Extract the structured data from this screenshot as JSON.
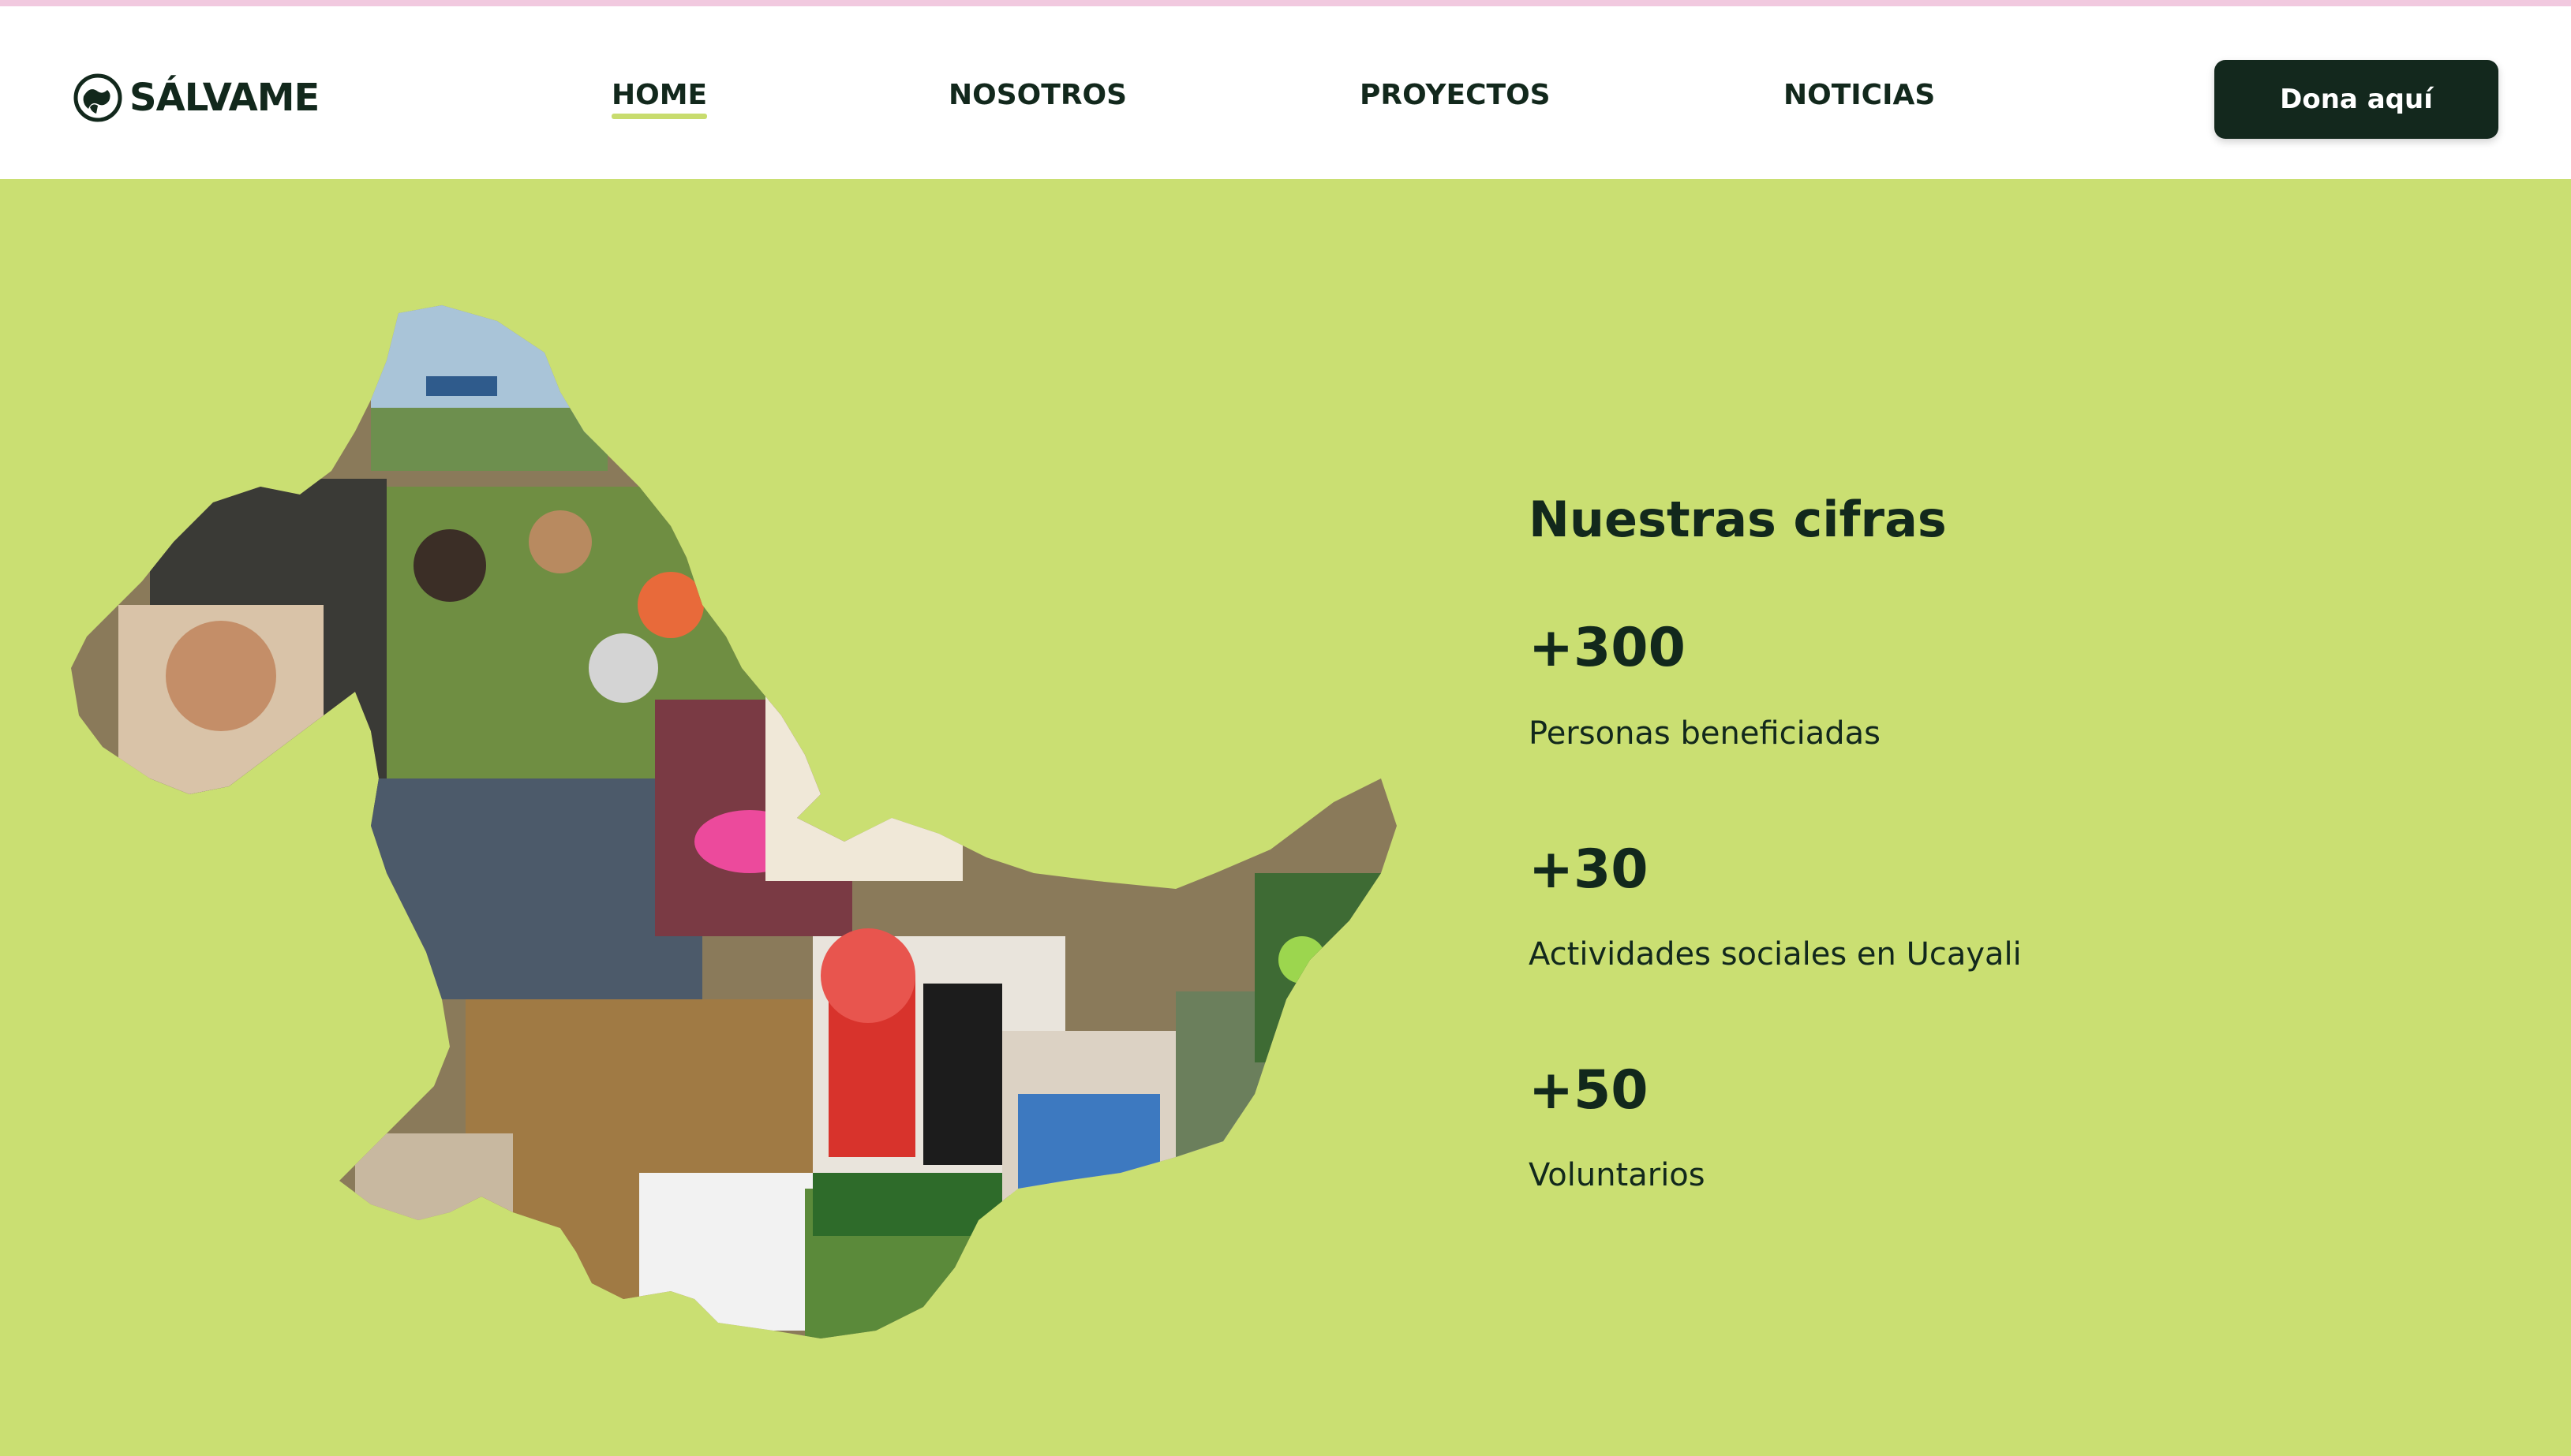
{
  "brand": {
    "name": "SÁLVAME",
    "logo_icon": "globe-hands-icon"
  },
  "nav": {
    "items": [
      {
        "label": "HOME",
        "active": true
      },
      {
        "label": "NOSOTROS",
        "active": false
      },
      {
        "label": "PROYECTOS",
        "active": false
      },
      {
        "label": "NOTICIAS",
        "active": false
      }
    ]
  },
  "cta": {
    "label": "Dona aquí"
  },
  "hero": {
    "image": "ucayali-map-photo-collage",
    "stats_title": "Nuestras cifras",
    "stats": [
      {
        "value": "+300",
        "label": "Personas beneficiadas"
      },
      {
        "value": "+30",
        "label": "Actividades sociales en Ucayali"
      },
      {
        "value": "+50",
        "label": "Voluntarios"
      }
    ]
  },
  "colors": {
    "background": "#cadf72",
    "text": "#12281c",
    "button": "#13281d",
    "accent_underline": "#c8dc6e",
    "top_border": "#f1c9df"
  }
}
